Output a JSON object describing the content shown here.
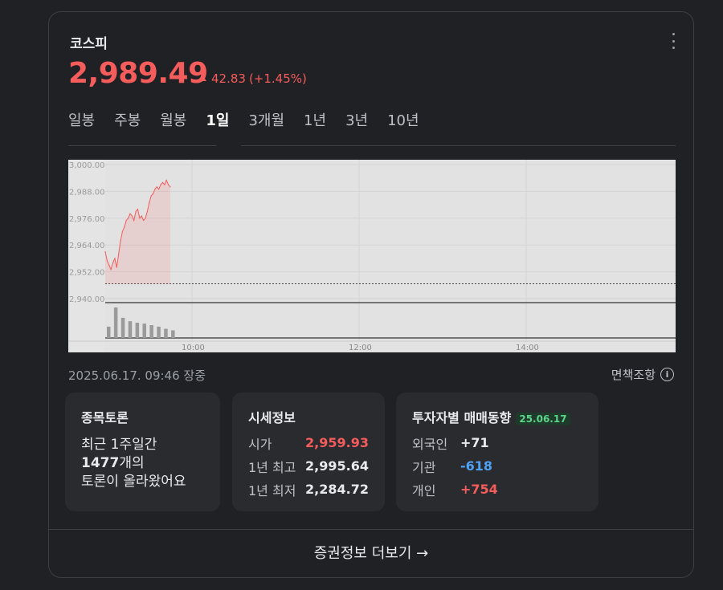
{
  "header": {
    "title": "코스피",
    "price": "2,989.49",
    "change": "42.83",
    "change_pct": "(+1.45%)",
    "color_up": "#f55c5c"
  },
  "tabs": [
    {
      "label": "일봉",
      "active": false
    },
    {
      "label": "주봉",
      "active": false
    },
    {
      "label": "월봉",
      "active": false
    },
    {
      "label": "1일",
      "active": true
    },
    {
      "label": "3개월",
      "active": false
    },
    {
      "label": "1년",
      "active": false
    },
    {
      "label": "3년",
      "active": false
    },
    {
      "label": "10년",
      "active": false
    }
  ],
  "chart_data": {
    "type": "line",
    "yticks": [
      "3,000.00",
      "2,988.00",
      "2,976.00",
      "2,964.00",
      "2,952.00",
      "2,940.00"
    ],
    "xticks": [
      "10:00",
      "12:00",
      "14:00"
    ],
    "prev_close": 2946.66,
    "ylim": [
      2940,
      3000
    ],
    "series": [
      {
        "values": [
          2961,
          2957,
          2955,
          2953,
          2956,
          2958,
          2954,
          2960,
          2966,
          2970,
          2972,
          2975,
          2976,
          2978,
          2977,
          2975,
          2979,
          2980,
          2976,
          2977,
          2975,
          2976,
          2979,
          2983,
          2986,
          2987,
          2989,
          2990,
          2989,
          2991,
          2992,
          2991,
          2993,
          2991,
          2990
        ]
      }
    ],
    "volume": [
      0.37,
      1.0,
      0.66,
      0.55,
      0.5,
      0.47,
      0.42,
      0.37,
      0.3,
      0.25
    ],
    "grid": true
  },
  "status": {
    "timestamp": "2025.06.17. 09:46 장중",
    "disclaimer": "면책조항",
    "info_icon": "i"
  },
  "discussion": {
    "title": "종목토론",
    "line1": "최근 1주일간",
    "count": "1477",
    "line2_suffix": "개의",
    "line3": "토론이 올라왔어요"
  },
  "price_info": {
    "title": "시세정보",
    "rows": [
      {
        "label": "시가",
        "value": "2,959.93",
        "color": "red"
      },
      {
        "label": "1년 최고",
        "value": "2,995.64",
        "color": "white"
      },
      {
        "label": "1년 최저",
        "value": "2,284.72",
        "color": "white"
      }
    ]
  },
  "investor": {
    "title": "투자자별 매매동향",
    "date": "25.06.17",
    "rows": [
      {
        "label": "외국인",
        "value": "+71",
        "color": "white"
      },
      {
        "label": "기관",
        "value": "-618",
        "color": "blue"
      },
      {
        "label": "개인",
        "value": "+754",
        "color": "red"
      }
    ]
  },
  "footer": {
    "label": "증권정보 더보기",
    "arrow": "→"
  }
}
